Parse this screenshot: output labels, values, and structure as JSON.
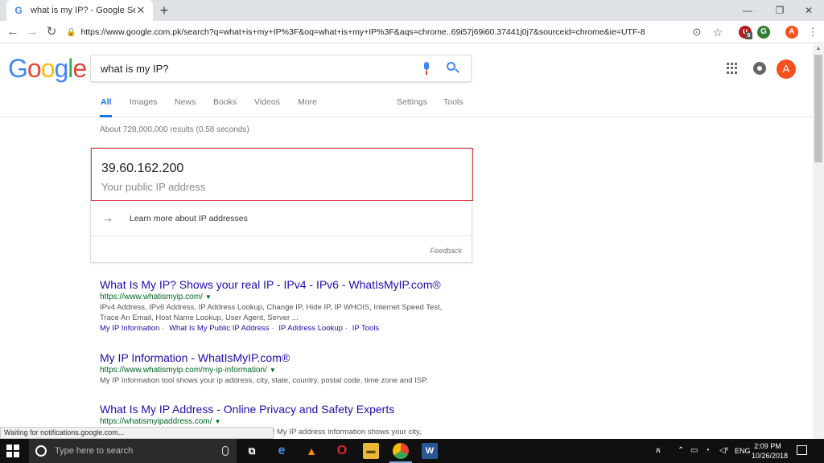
{
  "browser": {
    "tab_title": "what is my IP? - Google Search",
    "tab_favicon": "G",
    "url": "https://www.google.com.pk/search?q=what+is+my+IP%3F&oq=what+is+my+IP%3F&aqs=chrome..69i57j69i60.37441j0j7&sourceid=chrome&ie=UTF-8",
    "profile_initial": "A",
    "ext_badge": "9",
    "ext_u_label": "u",
    "ext_g_label": "G"
  },
  "google": {
    "logo_letters": [
      "G",
      "o",
      "o",
      "g",
      "l",
      "e"
    ],
    "query": "what is my IP?",
    "avatar_initial": "A",
    "tabs": [
      "All",
      "Images",
      "News",
      "Books",
      "Videos",
      "More"
    ],
    "tools": [
      "Settings",
      "Tools"
    ],
    "stats": "About 728,000,000 results (0.58 seconds)"
  },
  "ip_card": {
    "ip": "39.60.162.200",
    "label": "Your public IP address",
    "learn_more": "Learn more about IP addresses",
    "feedback": "Feedback"
  },
  "results": [
    {
      "title": "What Is My IP? Shows your real IP - IPv4 - IPv6 - WhatIsMyIP.com®",
      "url": "https://www.whatismyip.com/",
      "snippet_line1": "IPv4 Address, IPv6 Address, IP Address Lookup, Change IP, Hide IP, IP WHOIS, Internet Speed Test,",
      "snippet_line2": "Trace An Email, Host Name Lookup, User Agent, Server ...",
      "sitelinks": [
        "My IP Information",
        "What Is My Public IP Address",
        "IP Address Lookup",
        "IP Tools"
      ]
    },
    {
      "title": "My IP Information - WhatIsMyIP.com®",
      "url": "https://www.whatismyip.com/my-ip-information/",
      "snippet_line1": "My IP Information tool shows your ip address, city, state, country, postal code, time zone and ISP."
    },
    {
      "title": "What Is My IP Address - Online Privacy and Safety Experts",
      "url": "https://whatismyipaddress.com/",
      "snippet_line1": "rou! My IP address information shows your city,"
    }
  ],
  "status_text": "Waiting for notifications.google.com...",
  "taskbar": {
    "search_placeholder": "Type here to search",
    "time": "2:09 PM",
    "date": "10/26/2018",
    "language": "ENG"
  }
}
